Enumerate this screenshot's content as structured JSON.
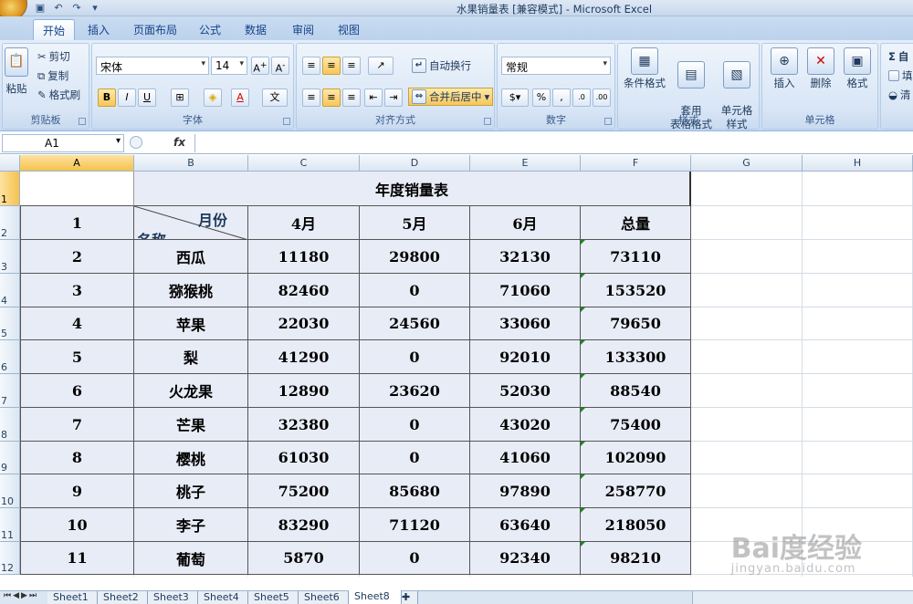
{
  "window": {
    "title": "水果销量表  [兼容模式] - Microsoft Excel"
  },
  "tabs": [
    "开始",
    "插入",
    "页面布局",
    "公式",
    "数据",
    "审阅",
    "视图"
  ],
  "ribbon": {
    "clipboard": {
      "paste": "粘贴",
      "cut": "剪切",
      "copy": "复制",
      "format_painter": "格式刷",
      "label": "剪贴板"
    },
    "font": {
      "name": "宋体",
      "size": "14",
      "bold": "B",
      "italic": "I",
      "underline": "U",
      "label": "字体"
    },
    "alignment": {
      "wrap": "自动换行",
      "merge": "合并后居中",
      "label": "对齐方式"
    },
    "number": {
      "format": "常规",
      "percent": "%",
      "comma": ",",
      "label": "数字"
    },
    "styles": {
      "conditional": "条件格式",
      "table": "套用\n表格格式",
      "cell": "单元格\n样式",
      "label": "样式"
    },
    "cells": {
      "insert": "插入",
      "delete": "删除",
      "format": "格式",
      "label": "单元格"
    },
    "editing": {
      "sum": "Σ",
      "fill": "填",
      "clear": "清"
    }
  },
  "formula_bar": {
    "name_box": "A1",
    "fx": "fx",
    "content": ""
  },
  "columns": [
    "A",
    "B",
    "C",
    "D",
    "E",
    "F",
    "G",
    "H"
  ],
  "rows": [
    "1",
    "2",
    "3",
    "4",
    "5",
    "6",
    "7",
    "8",
    "9",
    "10",
    "11",
    "12"
  ],
  "sheet": {
    "title": "年度销量表",
    "header": {
      "index": "1",
      "diag_top": "月份",
      "diag_bottom": "名称",
      "c": "4月",
      "d": "5月",
      "e": "6月",
      "f": "总量"
    },
    "data": [
      [
        "2",
        "西瓜",
        "11180",
        "29800",
        "32130",
        "73110"
      ],
      [
        "3",
        "猕猴桃",
        "82460",
        "0",
        "71060",
        "153520"
      ],
      [
        "4",
        "苹果",
        "22030",
        "24560",
        "33060",
        "79650"
      ],
      [
        "5",
        "梨",
        "41290",
        "0",
        "92010",
        "133300"
      ],
      [
        "6",
        "火龙果",
        "12890",
        "23620",
        "52030",
        "88540"
      ],
      [
        "7",
        "芒果",
        "32380",
        "0",
        "43020",
        "75400"
      ],
      [
        "8",
        "樱桃",
        "61030",
        "0",
        "41060",
        "102090"
      ],
      [
        "9",
        "桃子",
        "75200",
        "85680",
        "97890",
        "258770"
      ],
      [
        "10",
        "李子",
        "83290",
        "71120",
        "63640",
        "218050"
      ],
      [
        "11",
        "葡萄",
        "5870",
        "0",
        "92340",
        "98210"
      ]
    ]
  },
  "sheet_tabs": [
    "Sheet1",
    "Sheet2",
    "Sheet3",
    "Sheet4",
    "Sheet5",
    "Sheet6",
    "Sheet8"
  ],
  "active_sheet": "Sheet8",
  "watermark": {
    "main": "Bai度经验",
    "sub": "jingyan.baidu.com"
  }
}
